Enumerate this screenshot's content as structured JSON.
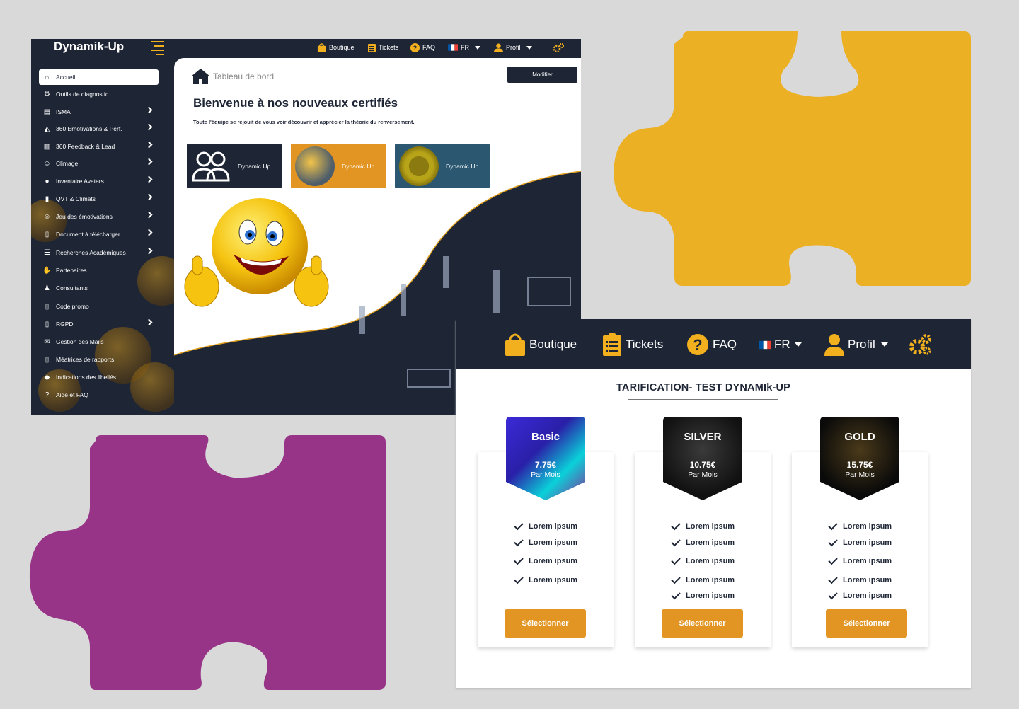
{
  "colors": {
    "puzzle_yellow": "#ecb024",
    "puzzle_purple": "#983488",
    "navy": "#1e2636",
    "accent": "#f2b01e",
    "button_orange": "#e29522"
  },
  "dashboard": {
    "brand": "Dynamik-Up",
    "topnav": {
      "shop": "Boutique",
      "tickets": "Tickets",
      "faq": "FAQ",
      "lang": "FR",
      "profile": "Profil"
    },
    "sidebar": [
      {
        "label": "Accueil",
        "icon": "home-icon",
        "chevron": false
      },
      {
        "label": "Outils de diagnostic",
        "icon": "gear-icon",
        "chevron": false
      },
      {
        "label": "ISMA",
        "icon": "id-card-icon",
        "chevron": true
      },
      {
        "label": "360 Emotivations & Perf.",
        "icon": "area-chart-icon",
        "chevron": true
      },
      {
        "label": "360 Feedback & Lead",
        "icon": "bar-chart-icon",
        "chevron": true
      },
      {
        "label": "Climage",
        "icon": "smile-icon",
        "chevron": true
      },
      {
        "label": "Inventaire Avatars",
        "icon": "user-circle-icon",
        "chevron": true
      },
      {
        "label": "QVT & Climats",
        "icon": "badge-icon",
        "chevron": true
      },
      {
        "label": "Jeu des émotivations",
        "icon": "smile-icon",
        "chevron": true
      },
      {
        "label": "Document à télécharger",
        "icon": "file-download-icon",
        "chevron": true
      },
      {
        "label": "Recherches Académiques",
        "icon": "list-icon",
        "chevron": true
      },
      {
        "label": "Partenaires",
        "icon": "handshake-icon",
        "chevron": false
      },
      {
        "label": "Consultants",
        "icon": "user-tie-icon",
        "chevron": false
      },
      {
        "label": "Code promo",
        "icon": "file-icon",
        "chevron": false
      },
      {
        "label": "RGPD",
        "icon": "file-icon",
        "chevron": true
      },
      {
        "label": "Gestion des Mails",
        "icon": "envelope-icon",
        "chevron": false
      },
      {
        "label": "Méatrices de rapports",
        "icon": "file-icon",
        "chevron": false
      },
      {
        "label": "Indications des libellés",
        "icon": "tags-icon",
        "chevron": false
      },
      {
        "label": "Aide et FAQ",
        "icon": "question-circle-icon",
        "chevron": false
      }
    ],
    "breadcrumb": "Tableau de bord",
    "modify_button": "Modifier",
    "welcome_title": "Bienvenue à nos nouveaux certifiés",
    "welcome_subtitle": "Toute l'équipe se réjouit de vous voir découvrir et apprécier la théorie du renversement.",
    "cards": [
      {
        "label": "Dynamic Up",
        "bg": "#1e2636"
      },
      {
        "label": "Dynamic Up",
        "bg": "#e29522"
      },
      {
        "label": "Dynamic Up",
        "bg": "#2b5870"
      }
    ]
  },
  "pricing": {
    "topnav": {
      "shop": "Boutique",
      "tickets": "Tickets",
      "faq": "FAQ",
      "lang": "FR",
      "profile": "Profil"
    },
    "title": "TARIFICATION- TEST DYNAMIk-UP",
    "plans": [
      {
        "name": "Basic",
        "price": "7.75€",
        "period": "Par Mois",
        "features": [
          "Lorem ipsum",
          "Lorem ipsum",
          "Lorem ipsum",
          "Lorem ipsum"
        ],
        "button": "Sélectionner"
      },
      {
        "name": "SILVER",
        "price": "10.75€",
        "period": "Par Mois",
        "features": [
          "Lorem ipsum",
          "Lorem ipsum",
          "Lorem ipsum",
          "Lorem ipsum",
          "Lorem ipsum"
        ],
        "button": "Sélectionner"
      },
      {
        "name": "GOLD",
        "price": "15.75€",
        "period": "Par Mois",
        "features": [
          "Lorem ipsum",
          "Lorem ipsum",
          "Lorem ipsum",
          "Lorem ipsum",
          "Lorem ipsum"
        ],
        "button": "Sélectionner"
      }
    ]
  }
}
